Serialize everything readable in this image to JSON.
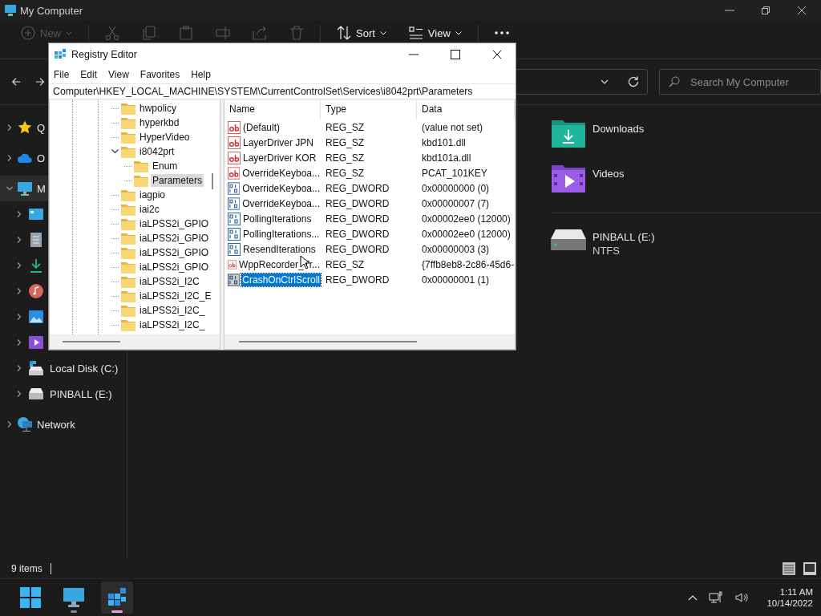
{
  "explorer": {
    "title": "My Computer",
    "toolbar": [
      {
        "kind": "new",
        "label": "New",
        "disabled": true
      },
      {
        "kind": "cut",
        "disabled": true
      },
      {
        "kind": "copy",
        "disabled": true
      },
      {
        "kind": "paste",
        "disabled": true
      },
      {
        "kind": "rename",
        "disabled": true
      },
      {
        "kind": "share",
        "disabled": true
      },
      {
        "kind": "delete",
        "disabled": true
      },
      {
        "kind": "sort",
        "label": "Sort",
        "disabled": false
      },
      {
        "kind": "view",
        "label": "View",
        "disabled": false
      },
      {
        "kind": "more",
        "disabled": false
      }
    ],
    "search": {
      "placeholder": "Search My Computer"
    },
    "sidebar": [
      {
        "kind": "star",
        "label": "Q",
        "expanded": false,
        "selected": false
      },
      {
        "kind": "cloud",
        "label": "O",
        "expanded": false,
        "selected": false
      },
      {
        "kind": "pc",
        "label": "M",
        "expanded": true,
        "selected": true,
        "children": [
          {
            "kind": "desktop",
            "expanded": false,
            "selected": false
          },
          {
            "kind": "document",
            "expanded": false,
            "selected": false
          },
          {
            "kind": "download",
            "expanded": false,
            "selected": false
          },
          {
            "kind": "music",
            "expanded": false,
            "selected": false
          },
          {
            "kind": "pictures",
            "expanded": false,
            "selected": false
          },
          {
            "kind": "videos",
            "expanded": false,
            "selected": false
          },
          {
            "kind": "disk",
            "label": "Local Disk (C:)",
            "expanded": false,
            "selected": false
          },
          {
            "kind": "drive",
            "label": "PINBALL (E:)",
            "expanded": false,
            "selected": false
          }
        ]
      },
      {
        "kind": "network",
        "label": "Network",
        "expanded": false,
        "selected": false
      }
    ],
    "content": [
      {
        "items": [
          {
            "kind": "downloads",
            "label": "Downloads"
          },
          {
            "kind": "videos",
            "label": "Videos"
          }
        ]
      },
      {
        "items": [
          {
            "kind": "drive",
            "label": "PINBALL (E:)",
            "detail": "NTFS"
          }
        ]
      }
    ],
    "status_bar": {
      "count": "9 items"
    }
  },
  "regedit": {
    "title": "Registry Editor",
    "menu": [
      "File",
      "Edit",
      "View",
      "Favorites",
      "Help"
    ],
    "address": "Computer\\HKEY_LOCAL_MACHINE\\SYSTEM\\CurrentControlSet\\Services\\i8042prt\\Parameters",
    "tree": [
      {
        "label": "hwpolicy",
        "selected": false
      },
      {
        "label": "hyperkbd",
        "selected": false
      },
      {
        "label": "HyperVideo",
        "selected": false
      },
      {
        "label": "i8042prt",
        "expanded": true,
        "selected": false,
        "children": [
          {
            "label": "Enum",
            "selected": false
          },
          {
            "label": "Parameters",
            "selected": true
          }
        ]
      },
      {
        "label": "iagpio",
        "selected": false
      },
      {
        "label": "iai2c",
        "selected": false
      },
      {
        "label": "iaLPSS2i_GPIO",
        "selected": false
      },
      {
        "label": "iaLPSS2i_GPIO",
        "selected": false
      },
      {
        "label": "iaLPSS2i_GPIO",
        "selected": false
      },
      {
        "label": "iaLPSS2i_GPIO",
        "selected": false
      },
      {
        "label": "iaLPSS2i_I2C",
        "selected": false
      },
      {
        "label": "iaLPSS2i_I2C_E",
        "selected": false
      },
      {
        "label": "iaLPSS2i_I2C_",
        "selected": false
      },
      {
        "label": "iaLPSS2i_I2C_",
        "selected": false
      }
    ],
    "columns": [
      "Name",
      "Type",
      "Data"
    ],
    "rows": [
      {
        "kind": "string",
        "name": "(Default)",
        "type": "REG_SZ",
        "data": "(value not set)",
        "selected": false
      },
      {
        "kind": "string",
        "name": "LayerDriver JPN",
        "type": "REG_SZ",
        "data": "kbd101.dll",
        "selected": false
      },
      {
        "kind": "string",
        "name": "LayerDriver KOR",
        "type": "REG_SZ",
        "data": "kbd101a.dll",
        "selected": false
      },
      {
        "kind": "string",
        "name": "OverrideKeyboa...",
        "type": "REG_SZ",
        "data": "PCAT_101KEY",
        "selected": false
      },
      {
        "kind": "binary",
        "name": "OverrideKeyboa...",
        "type": "REG_DWORD",
        "data": "0x00000000 (0)",
        "selected": false
      },
      {
        "kind": "binary",
        "name": "OverrideKeyboa...",
        "type": "REG_DWORD",
        "data": "0x00000007 (7)",
        "selected": false
      },
      {
        "kind": "binary",
        "name": "PollingIterations",
        "type": "REG_DWORD",
        "data": "0x00002ee0 (12000)",
        "selected": false
      },
      {
        "kind": "binary",
        "name": "PollingIterations...",
        "type": "REG_DWORD",
        "data": "0x00002ee0 (12000)",
        "selected": false
      },
      {
        "kind": "binary",
        "name": "ResendIterations",
        "type": "REG_DWORD",
        "data": "0x00000003 (3)",
        "selected": false
      },
      {
        "kind": "string",
        "name": "WppRecorder_Tr...",
        "type": "REG_SZ",
        "data": "{7ffb8eb8-2c86-45d6-",
        "selected": false
      },
      {
        "kind": "binary",
        "name": "CrashOnCtrlScroll",
        "type": "REG_DWORD",
        "data": "0x00000001 (1)",
        "selected": true
      }
    ]
  },
  "taskbar": {
    "apps": [
      {
        "kind": "start",
        "running": false,
        "active": false
      },
      {
        "kind": "computer",
        "running": true,
        "active": false
      },
      {
        "kind": "regedit",
        "running": true,
        "active": true
      }
    ],
    "time": "1:11 AM",
    "date": "10/14/2022"
  }
}
